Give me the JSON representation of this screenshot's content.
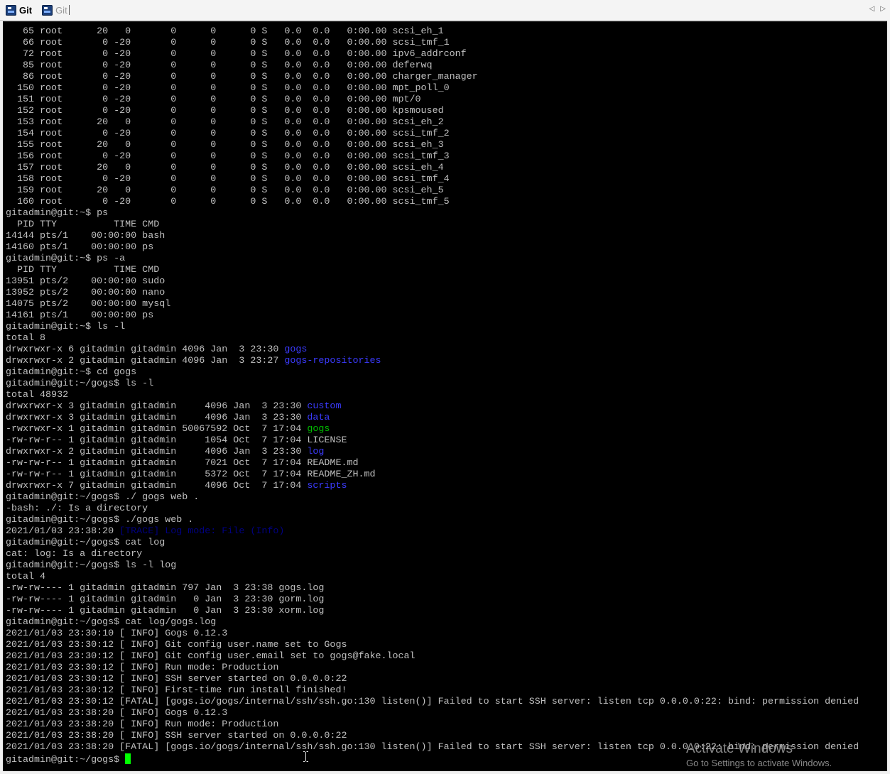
{
  "tabs": [
    {
      "label": "Git",
      "active": true,
      "icon": "putty-icon"
    },
    {
      "label": "Git",
      "active": false,
      "icon": "putty-icon"
    }
  ],
  "tab_scroll": {
    "left": "◁",
    "right": "▷"
  },
  "terminal": {
    "lines": [
      [
        {
          "t": "   65 root      20   0       0      0      0 S   0.0  0.0   0:00.00 scsi_eh_1"
        }
      ],
      [
        {
          "t": "   66 root       0 -20       0      0      0 S   0.0  0.0   0:00.00 scsi_tmf_1"
        }
      ],
      [
        {
          "t": "   72 root       0 -20       0      0      0 S   0.0  0.0   0:00.00 ipv6_addrconf"
        }
      ],
      [
        {
          "t": "   85 root       0 -20       0      0      0 S   0.0  0.0   0:00.00 deferwq"
        }
      ],
      [
        {
          "t": "   86 root       0 -20       0      0      0 S   0.0  0.0   0:00.00 charger_manager"
        }
      ],
      [
        {
          "t": "  150 root       0 -20       0      0      0 S   0.0  0.0   0:00.00 mpt_poll_0"
        }
      ],
      [
        {
          "t": "  151 root       0 -20       0      0      0 S   0.0  0.0   0:00.00 mpt/0"
        }
      ],
      [
        {
          "t": "  152 root       0 -20       0      0      0 S   0.0  0.0   0:00.00 kpsmoused"
        }
      ],
      [
        {
          "t": "  153 root      20   0       0      0      0 S   0.0  0.0   0:00.00 scsi_eh_2"
        }
      ],
      [
        {
          "t": "  154 root       0 -20       0      0      0 S   0.0  0.0   0:00.00 scsi_tmf_2"
        }
      ],
      [
        {
          "t": "  155 root      20   0       0      0      0 S   0.0  0.0   0:00.00 scsi_eh_3"
        }
      ],
      [
        {
          "t": "  156 root       0 -20       0      0      0 S   0.0  0.0   0:00.00 scsi_tmf_3"
        }
      ],
      [
        {
          "t": "  157 root      20   0       0      0      0 S   0.0  0.0   0:00.00 scsi_eh_4"
        }
      ],
      [
        {
          "t": "  158 root       0 -20       0      0      0 S   0.0  0.0   0:00.00 scsi_tmf_4"
        }
      ],
      [
        {
          "t": "  159 root      20   0       0      0      0 S   0.0  0.0   0:00.00 scsi_eh_5"
        }
      ],
      [
        {
          "t": "  160 root       0 -20       0      0      0 S   0.0  0.0   0:00.00 scsi_tmf_5"
        }
      ],
      [
        {
          "t": "gitadmin@git:~$ ps"
        }
      ],
      [
        {
          "t": "  PID TTY          TIME CMD"
        }
      ],
      [
        {
          "t": "14144 pts/1    00:00:00 bash"
        }
      ],
      [
        {
          "t": "14160 pts/1    00:00:00 ps"
        }
      ],
      [
        {
          "t": "gitadmin@git:~$ ps -a"
        }
      ],
      [
        {
          "t": "  PID TTY          TIME CMD"
        }
      ],
      [
        {
          "t": "13951 pts/2    00:00:00 sudo"
        }
      ],
      [
        {
          "t": "13952 pts/2    00:00:00 nano"
        }
      ],
      [
        {
          "t": "14075 pts/2    00:00:00 mysql"
        }
      ],
      [
        {
          "t": "14161 pts/1    00:00:00 ps"
        }
      ],
      [
        {
          "t": "gitadmin@git:~$ ls -l"
        }
      ],
      [
        {
          "t": "total 8"
        }
      ],
      [
        {
          "t": "drwxrwxr-x 6 gitadmin gitadmin 4096 Jan  3 23:30 "
        },
        {
          "t": "gogs",
          "c": "blue"
        }
      ],
      [
        {
          "t": "drwxrwxr-x 2 gitadmin gitadmin 4096 Jan  3 23:27 "
        },
        {
          "t": "gogs-repositories",
          "c": "blue"
        }
      ],
      [
        {
          "t": "gitadmin@git:~$ cd gogs"
        }
      ],
      [
        {
          "t": "gitadmin@git:~/gogs$ ls -l"
        }
      ],
      [
        {
          "t": "total 48932"
        }
      ],
      [
        {
          "t": "drwxrwxr-x 3 gitadmin gitadmin     4096 Jan  3 23:30 "
        },
        {
          "t": "custom",
          "c": "blue"
        }
      ],
      [
        {
          "t": "drwxrwxr-x 3 gitadmin gitadmin     4096 Jan  3 23:30 "
        },
        {
          "t": "data",
          "c": "blue"
        }
      ],
      [
        {
          "t": "-rwxrwxr-x 1 gitadmin gitadmin 50067592 Oct  7 17:04 "
        },
        {
          "t": "gogs",
          "c": "green"
        }
      ],
      [
        {
          "t": "-rw-rw-r-- 1 gitadmin gitadmin     1054 Oct  7 17:04 LICENSE"
        }
      ],
      [
        {
          "t": "drwxrwxr-x 2 gitadmin gitadmin     4096 Jan  3 23:30 "
        },
        {
          "t": "log",
          "c": "blue"
        }
      ],
      [
        {
          "t": "-rw-rw-r-- 1 gitadmin gitadmin     7021 Oct  7 17:04 README.md"
        }
      ],
      [
        {
          "t": "-rw-rw-r-- 1 gitadmin gitadmin     5372 Oct  7 17:04 README_ZH.md"
        }
      ],
      [
        {
          "t": "drwxrwxr-x 7 gitadmin gitadmin     4096 Oct  7 17:04 "
        },
        {
          "t": "scripts",
          "c": "blue"
        }
      ],
      [
        {
          "t": "gitadmin@git:~/gogs$ ./ gogs web ."
        }
      ],
      [
        {
          "t": "-bash: ./: Is a directory"
        }
      ],
      [
        {
          "t": "gitadmin@git:~/gogs$ ./gogs web ."
        }
      ],
      [
        {
          "t": "2021/01/03 23:38:20 "
        },
        {
          "t": "[TRACE] Log mode: File (Info)",
          "c": "dblue"
        }
      ],
      [
        {
          "t": "gitadmin@git:~/gogs$ cat log"
        }
      ],
      [
        {
          "t": "cat: log: Is a directory"
        }
      ],
      [
        {
          "t": "gitadmin@git:~/gogs$ ls -l log"
        }
      ],
      [
        {
          "t": "total 4"
        }
      ],
      [
        {
          "t": "-rw-rw---- 1 gitadmin gitadmin 797 Jan  3 23:38 gogs.log"
        }
      ],
      [
        {
          "t": "-rw-rw---- 1 gitadmin gitadmin   0 Jan  3 23:30 gorm.log"
        }
      ],
      [
        {
          "t": "-rw-rw---- 1 gitadmin gitadmin   0 Jan  3 23:30 xorm.log"
        }
      ],
      [
        {
          "t": "gitadmin@git:~/gogs$ cat log/gogs.log"
        }
      ],
      [
        {
          "t": "2021/01/03 23:30:10 [ INFO] Gogs 0.12.3"
        }
      ],
      [
        {
          "t": "2021/01/03 23:30:12 [ INFO] Git config user.name set to Gogs"
        }
      ],
      [
        {
          "t": "2021/01/03 23:30:12 [ INFO] Git config user.email set to gogs@fake.local"
        }
      ],
      [
        {
          "t": "2021/01/03 23:30:12 [ INFO] Run mode: Production"
        }
      ],
      [
        {
          "t": "2021/01/03 23:30:12 [ INFO] SSH server started on 0.0.0.0:22"
        }
      ],
      [
        {
          "t": "2021/01/03 23:30:12 [ INFO] First-time run install finished!"
        }
      ],
      [
        {
          "t": "2021/01/03 23:30:12 [FATAL] [gogs.io/gogs/internal/ssh/ssh.go:130 listen()] Failed to start SSH server: listen tcp 0.0.0.0:22: bind: permission denied"
        }
      ],
      [
        {
          "t": "2021/01/03 23:38:20 [ INFO] Gogs 0.12.3"
        }
      ],
      [
        {
          "t": "2021/01/03 23:38:20 [ INFO] Run mode: Production"
        }
      ],
      [
        {
          "t": "2021/01/03 23:38:20 [ INFO] SSH server started on 0.0.0.0:22"
        }
      ],
      [
        {
          "t": "2021/01/03 23:38:20 [FATAL] [gogs.io/gogs/internal/ssh/ssh.go:130 listen()] Failed to start SSH server: listen tcp 0.0.0.0:22: bind: permission denied"
        }
      ]
    ],
    "prompt": "gitadmin@git:~/gogs$ "
  },
  "watermark": {
    "title": "Activate Windows",
    "subtitle": "Go to Settings to activate Windows."
  },
  "colors": {
    "terminal_bg": "#000000",
    "terminal_fg": "#c0c0c0",
    "dir_blue": "#3b3bff",
    "exec_green": "#00c000",
    "cursor": "#00ff00"
  }
}
